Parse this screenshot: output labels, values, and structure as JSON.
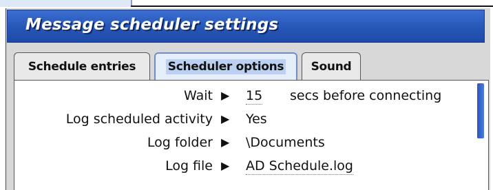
{
  "dialog": {
    "title": "Message scheduler settings"
  },
  "tabs": [
    {
      "label": "Schedule entries",
      "selected": false
    },
    {
      "label": "Scheduler options",
      "selected": true
    },
    {
      "label": "Sound",
      "selected": false
    }
  ],
  "options": {
    "arrow_glyph": "▶",
    "wait": {
      "label": "Wait",
      "value": "15",
      "suffix": "secs before connecting"
    },
    "log_activity": {
      "label": "Log scheduled activity",
      "value": "Yes"
    },
    "log_folder": {
      "label": "Log folder",
      "value": "\\Documents"
    },
    "log_file": {
      "label": "Log file",
      "value": "AD Schedule.log"
    }
  },
  "colors": {
    "titlebar": "#2755b8",
    "selected_tab": "#bcd0f2",
    "scrollbar": "#2a57b8"
  }
}
